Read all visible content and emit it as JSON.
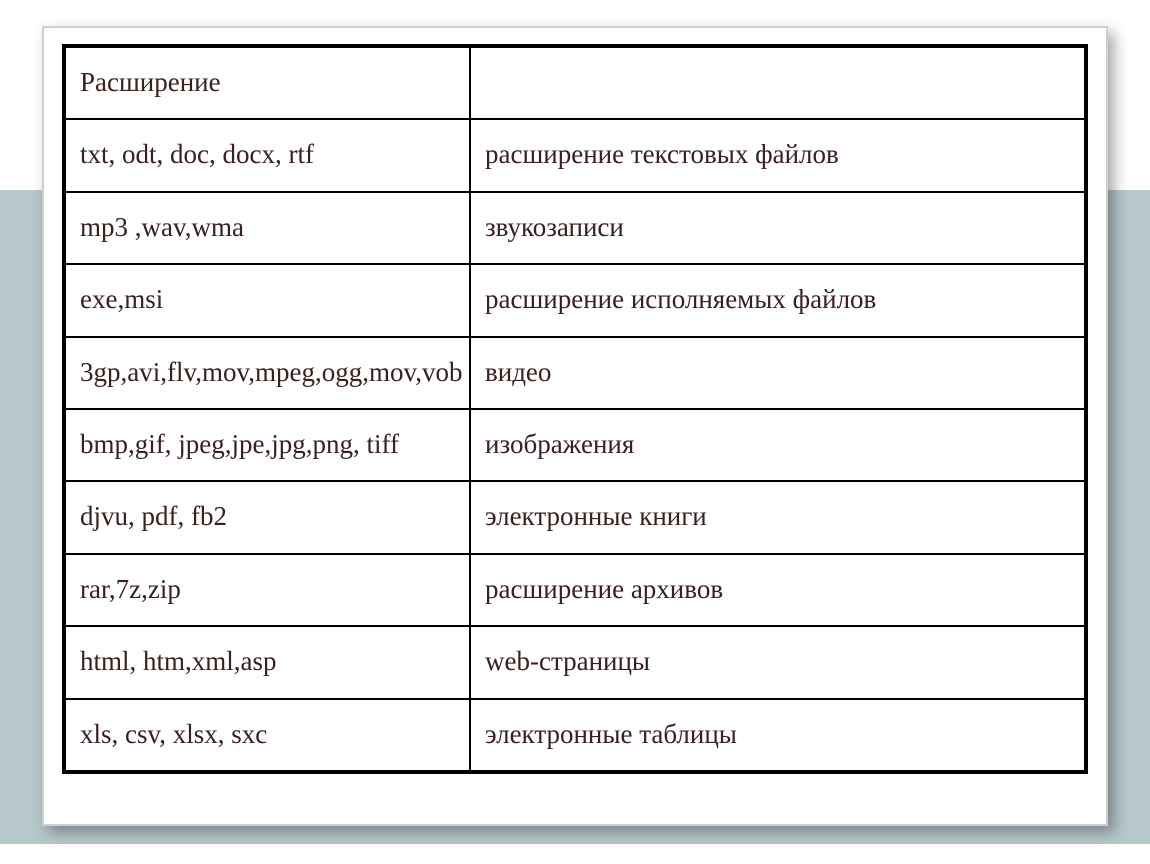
{
  "table": {
    "header": {
      "col1": "Расширение",
      "col2": ""
    },
    "rows": [
      {
        "ext": "txt, odt, doc, docx, rtf",
        "desc": "расширение текстовых файлов"
      },
      {
        "ext": "mp3 ,wav,wma",
        "desc": "звукозаписи"
      },
      {
        "ext": "exe,msi",
        "desc": "расширение исполняемых файлов"
      },
      {
        "ext": "3gp,avi,flv,mov,mpeg,ogg,mov,vob",
        "desc": " видео"
      },
      {
        "ext": "bmp,gif, jpeg,jpe,jpg,png, tiff",
        "desc": "изображения"
      },
      {
        "ext": "djvu, pdf, fb2",
        "desc": "электронные книги"
      },
      {
        "ext": "rar,7z,zip",
        "desc": "расширение архивов"
      },
      {
        "ext": "html, htm,xml,asp",
        "desc": "web-страницы"
      },
      {
        "ext": "xls, csv, xlsx, sxc",
        "desc": "электронные таблицы"
      }
    ]
  }
}
